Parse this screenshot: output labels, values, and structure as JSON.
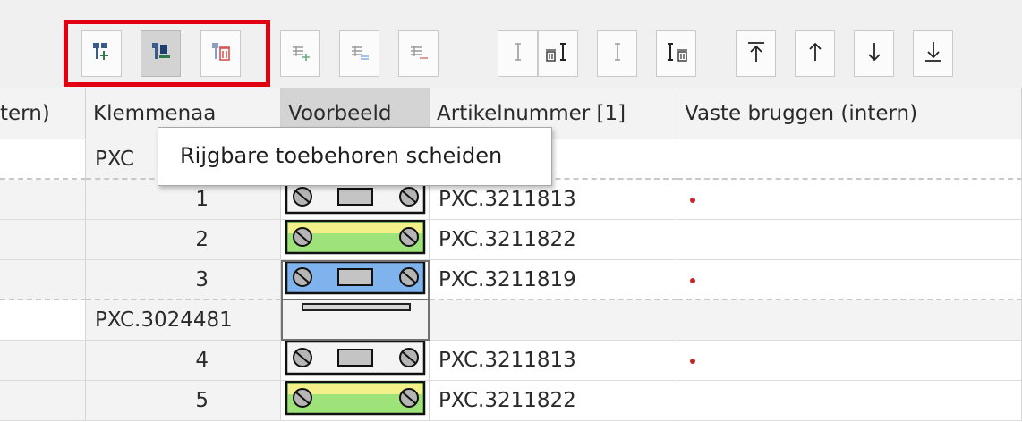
{
  "toolbar": {
    "groups": [
      {
        "buttons": [
          {
            "name": "attach-accessory-button",
            "icon": "accessory-insert-icon",
            "pressed": false
          },
          {
            "name": "attach-accessory-alt-button",
            "icon": "accessory-place-icon",
            "pressed": true
          },
          {
            "name": "remove-accessory-button",
            "icon": "accessory-delete-icon",
            "pressed": false
          }
        ]
      },
      {
        "buttons": [
          {
            "name": "insert-terminal-button",
            "icon": "terminal-add-icon"
          },
          {
            "name": "duplicate-terminal-button",
            "icon": "terminal-copy-icon"
          },
          {
            "name": "remove-terminal-button",
            "icon": "terminal-remove-icon"
          }
        ]
      },
      {
        "buttons": [
          {
            "name": "insert-bridge-button",
            "icon": "bridge-insert-icon"
          },
          {
            "name": "bridge-delete-left-button",
            "icon": "bridge-delete-left-icon"
          },
          {
            "name": "bridge-plain-button",
            "icon": "bridge-plain-icon"
          },
          {
            "name": "bridge-delete-right-button",
            "icon": "bridge-delete-right-icon"
          }
        ]
      },
      {
        "buttons": [
          {
            "name": "move-to-top-button",
            "icon": "arrow-top-icon",
            "glyph": "⭱"
          },
          {
            "name": "move-up-button",
            "icon": "arrow-up-icon",
            "glyph": "↑"
          },
          {
            "name": "move-down-button",
            "icon": "arrow-down-icon",
            "glyph": "↓"
          },
          {
            "name": "move-to-bottom-button",
            "icon": "arrow-bottom-icon",
            "glyph": "⭳"
          }
        ]
      }
    ]
  },
  "columns": {
    "c0": "tern)",
    "c1": "Klemmenaa",
    "c2": "Voorbeeld",
    "c3": "Artikelnummer [1]",
    "c4": "Vaste bruggen (intern)"
  },
  "rows": [
    {
      "type": "group",
      "label": "PXC"
    },
    {
      "type": "terminal",
      "num": "1",
      "art": "PXC.3211813",
      "preview": "gray",
      "bridge": true
    },
    {
      "type": "terminal",
      "num": "2",
      "art": "PXC.3211822",
      "preview": "green",
      "bridge": false
    },
    {
      "type": "terminal",
      "num": "3",
      "art": "PXC.3211819",
      "preview": "blue",
      "bridge": true,
      "selected": true
    },
    {
      "type": "group",
      "label": "PXC.3024481",
      "preview": "bar"
    },
    {
      "type": "terminal",
      "num": "4",
      "art": "PXC.3211813",
      "preview": "gray",
      "bridge": true
    },
    {
      "type": "terminal",
      "num": "5",
      "art": "PXC.3211822",
      "preview": "green",
      "bridge": false
    }
  ],
  "tooltip": {
    "text": "Rijgbare toebehoren scheiden"
  },
  "colors": {
    "highlight": "#e00012",
    "bridge_dot": "#c0282d",
    "blue": "#7fb3ee",
    "green": "#9ee27a",
    "yellow": "#f3f08a"
  }
}
